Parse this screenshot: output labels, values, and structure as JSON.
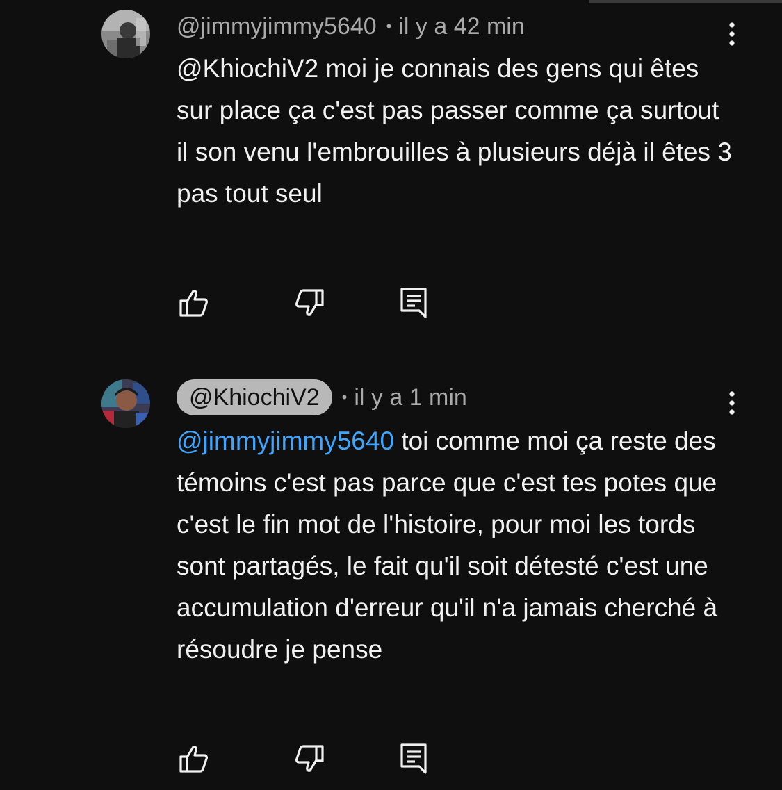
{
  "comments": [
    {
      "author": "@jimmyjimmy5640",
      "time": "il y a 42 min",
      "separator": "•",
      "text": "@KhiochiV2 moi je connais des gens qui êtes sur place ça c'est pas passer comme ça surtout il son venu l'embrouilles à plusieurs déjà il êtes 3 pas tout seul",
      "avatar_icon": "user-avatar",
      "menu_icon": "more-vert-icon"
    },
    {
      "author": "@KhiochiV2",
      "author_highlighted": true,
      "time": "il y a 1 min",
      "separator": "•",
      "mention": "@jimmyjimmy5640",
      "text": " toi comme moi ça reste des témoins c'est pas parce que c'est tes potes que c'est le fin mot de l'histoire, pour moi les tords sont partagés, le fait qu'il soit détesté c'est une accumulation d'erreur qu'il n'a jamais cherché à résoudre je pense",
      "avatar_icon": "user-avatar",
      "menu_icon": "more-vert-icon"
    }
  ],
  "actions": {
    "like_icon": "thumbs-up-icon",
    "dislike_icon": "thumbs-down-icon",
    "reply_icon": "reply-comment-icon"
  },
  "colors": {
    "background": "#0f0f0f",
    "text": "#f1f1f1",
    "secondary_text": "#aaaaaa",
    "mention": "#3ea6ff",
    "highlight_pill": "#b8b8b8"
  }
}
